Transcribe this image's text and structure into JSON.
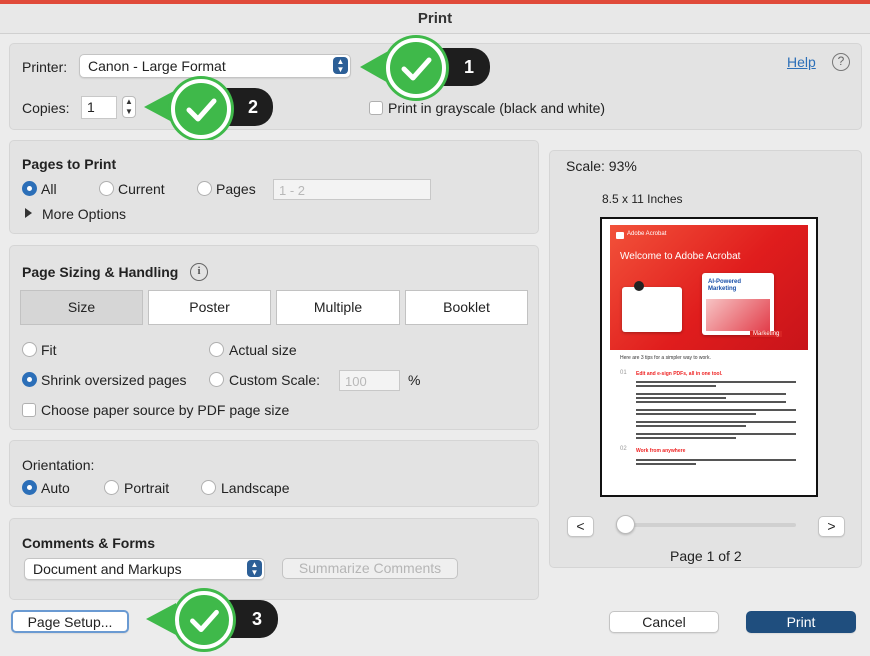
{
  "window": {
    "title": "Print"
  },
  "printer": {
    "label": "Printer:",
    "selected": "Canon - Large Format",
    "help": "Help",
    "help_icon": "?"
  },
  "copies": {
    "label": "Copies:",
    "value": "1"
  },
  "grayscale": {
    "label": "Print in grayscale (black and white)"
  },
  "pages_to_print": {
    "heading": "Pages to Print",
    "options": [
      "All",
      "Current",
      "Pages"
    ],
    "selected": "All",
    "range_placeholder": "1 - 2",
    "more_options": "More Options"
  },
  "sizing": {
    "heading": "Page Sizing & Handling",
    "tabs": [
      "Size",
      "Poster",
      "Multiple",
      "Booklet"
    ],
    "fit": "Fit",
    "actual_size": "Actual size",
    "shrink": "Shrink oversized pages",
    "custom_scale": "Custom Scale:",
    "custom_scale_value": "100",
    "percent": "%",
    "paper_source": "Choose paper source by PDF page size"
  },
  "orientation": {
    "heading": "Orientation:",
    "options": [
      "Auto",
      "Portrait",
      "Landscape"
    ]
  },
  "comments": {
    "heading": "Comments & Forms",
    "selected": "Document and Markups",
    "summarize": "Summarize Comments"
  },
  "preview": {
    "scale": "Scale:  93%",
    "paper": "8.5 x 11 Inches",
    "page_counter": "Page 1 of 2",
    "prev": "<",
    "next": ">",
    "doc": {
      "brand": "Adobe Acrobat",
      "headline": "Welcome to Adobe Acrobat",
      "card_title": "AI-Powered Marketing",
      "card_tag": "Marketing",
      "intro": "Here are 3 tips for a simpler way to work.",
      "tip1_num": "01",
      "tip1_title": "Edit and e-sign PDFs, all in one tool.",
      "tip2_num": "02",
      "tip2_title": "Work from anywhere"
    }
  },
  "buttons": {
    "page_setup": "Page Setup...",
    "cancel": "Cancel",
    "print": "Print"
  },
  "callouts": [
    "1",
    "2",
    "3"
  ],
  "colors": {
    "accent": "#2c6fb8",
    "callout_green": "#3fb94a",
    "print_button": "#1f4e7e"
  }
}
